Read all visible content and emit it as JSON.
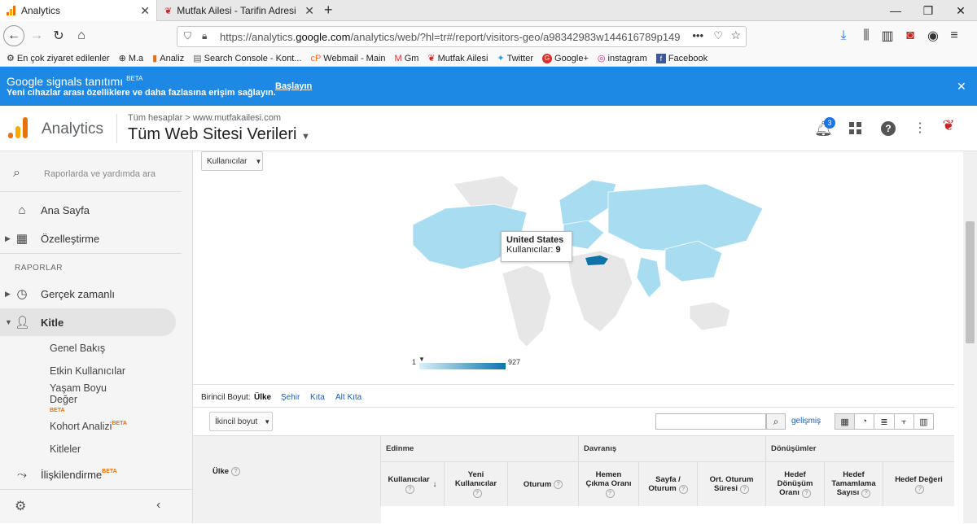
{
  "browser": {
    "tabs": [
      {
        "title": "Analytics"
      },
      {
        "title": "Mutfak Ailesi - Tarifin Adresi - N"
      }
    ],
    "url_prefix": "https://analytics.",
    "url_domain": "google.com",
    "url_rest": "/analytics/web/?hl=tr#/report/visitors-geo/a98342983w144616789p149",
    "url_more": "•••",
    "bookmarks": [
      {
        "label": "En çok ziyaret edilenler",
        "icon": "gear-icon"
      },
      {
        "label": "M.a",
        "icon": "globe-icon"
      },
      {
        "label": "Analiz",
        "icon": "analytics-icon"
      },
      {
        "label": "Search Console - Kont...",
        "icon": "search-console-icon"
      },
      {
        "label": "Webmail - Main",
        "icon": "cpanel-icon"
      },
      {
        "label": "Gm",
        "icon": "gmail-icon"
      },
      {
        "label": "Mutfak Ailesi",
        "icon": "mutfak-icon"
      },
      {
        "label": "Twitter",
        "icon": "twitter-icon"
      },
      {
        "label": "Google+",
        "icon": "googleplus-icon"
      },
      {
        "label": "instagram",
        "icon": "instagram-icon"
      },
      {
        "label": "Facebook",
        "icon": "facebook-icon"
      }
    ]
  },
  "banner": {
    "title": "Google signals tanıtımı",
    "badge": "BETA",
    "subtitle": "Yeni cihazlar arası özelliklere ve daha fazlasına erişim sağlayın.",
    "cta": "Başlayın",
    "close": "✕"
  },
  "header": {
    "app_name": "Analytics",
    "breadcrumb_root": "Tüm hesaplar",
    "breadcrumb_sep": ">",
    "breadcrumb_site": "www.mutfakailesi.com",
    "property": "Tüm Web Sitesi Verileri",
    "notifications": "3"
  },
  "sidebar": {
    "search_placeholder": "Raporlarda ve yardımda ara",
    "home": "Ana Sayfa",
    "customize": "Özelleştirme",
    "section": "RAPORLAR",
    "realtime": "Gerçek zamanlı",
    "audience": "Kitle",
    "audience_sub": [
      {
        "label": "Genel Bakış"
      },
      {
        "label": "Etkin Kullanıcılar"
      },
      {
        "label": "Yaşam Boyu Değer",
        "label1": "Yaşam Boyu",
        "label2": "Değer",
        "badge": "BETA"
      },
      {
        "label": "Kohort Analizi",
        "badge": "BETA"
      },
      {
        "label": "Kitleler"
      }
    ],
    "attribution": "İlişkilendirme",
    "attribution_badge": "BETA"
  },
  "report": {
    "metric_dropdown": "Kullanıcılar",
    "tooltip_country": "United States",
    "tooltip_metric": "Kullanıcılar:",
    "tooltip_value": "9",
    "legend_min": "1",
    "legend_max": "927",
    "primary_dim_label": "Birincil Boyut:",
    "primary_dims": [
      "Ülke",
      "Şehir",
      "Kıta",
      "Alt Kıta"
    ],
    "secondary_dim": "İkincil boyut",
    "advanced": "gelişmiş",
    "table": {
      "dim_col": "Ülke",
      "groups": [
        "Edinme",
        "Davranış",
        "Dönüşümler"
      ],
      "cols": [
        {
          "line1": "Kullanıcılar",
          "line2": ""
        },
        {
          "line1": "Yeni",
          "line2": "Kullanıcılar"
        },
        {
          "line1": "Oturum",
          "line2": ""
        },
        {
          "line1": "Hemen",
          "line2": "Çıkma Oranı"
        },
        {
          "line1": "Sayfa /",
          "line2": "Oturum"
        },
        {
          "line1": "Ort. Oturum",
          "line2": "Süresi"
        },
        {
          "line1": "Hedef",
          "line2": "Dönüşüm",
          "line3": "Oranı"
        },
        {
          "line1": "Hedef",
          "line2": "Tamamlama",
          "line3": "Sayısı"
        },
        {
          "line1": "Hedef Değeri",
          "line2": ""
        }
      ]
    }
  },
  "colors": {
    "banner": "#1e88e5",
    "map_light": "#a8dcf0",
    "map_dark": "#0f72a8",
    "accent": "#e8710a"
  }
}
